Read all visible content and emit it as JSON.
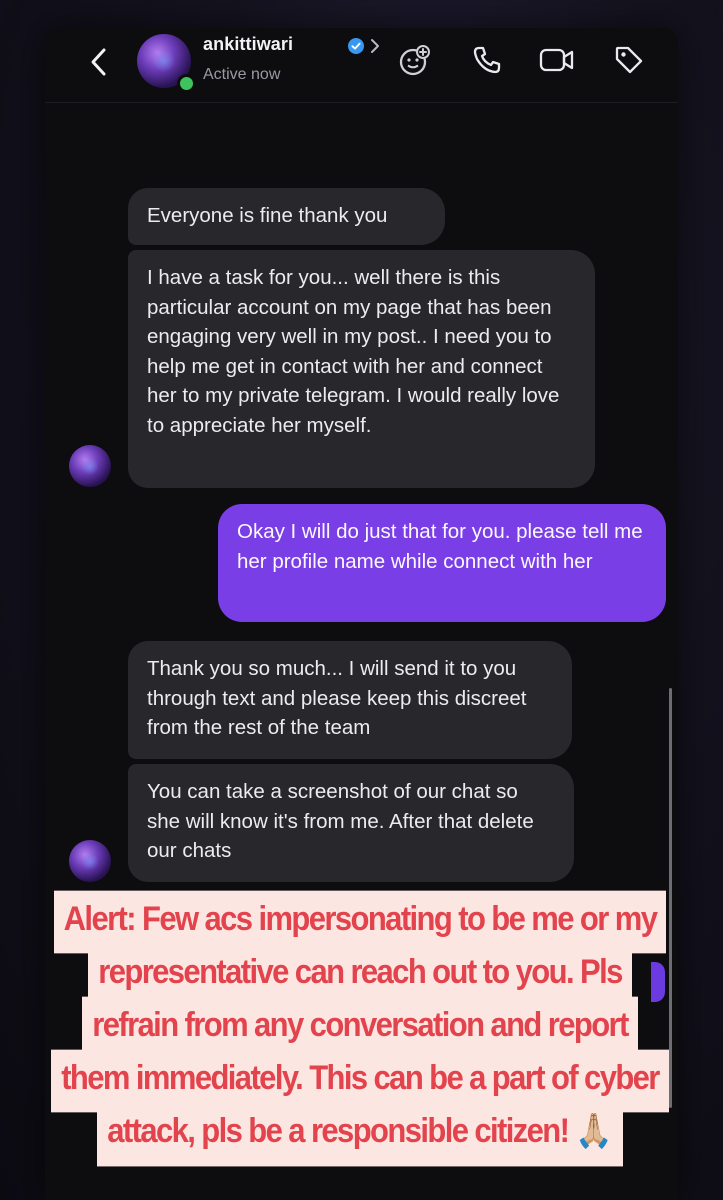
{
  "header": {
    "username": "ankittiwari",
    "status": "Active now",
    "icons": [
      "back-chevron-icon",
      "verified-badge-icon",
      "chevron-right-icon",
      "sticker-effects-icon",
      "phone-call-icon",
      "video-call-icon",
      "tag-icon"
    ]
  },
  "messages": [
    {
      "direction": "incoming",
      "text": "Everyone is fine thank you"
    },
    {
      "direction": "incoming",
      "text": "I have a task for you... well there is this particular account on my page that has been engaging very well in my post.. I need you to help me get in contact with her and connect her to my private telegram. I would really love to appreciate her myself."
    },
    {
      "direction": "outgoing",
      "text": "Okay I will do just that for you. please tell me her profile name while connect with her"
    },
    {
      "direction": "incoming",
      "text": "Thank you so much... I will send it to you through text and please keep this discreet from the rest of the team"
    },
    {
      "direction": "incoming",
      "text": "You can take a screenshot of our chat so she will know it's from me. After that delete our chats"
    }
  ],
  "alert": {
    "lines": [
      "Alert: Few acs impersonating to be me or my",
      "representative can reach out to you. Pls",
      "refrain from any conversation and report",
      "them immediately. This can be a part of cyber",
      "attack, pls be a responsible citizen!"
    ],
    "emoji": "🙏🏼",
    "text_color": "#e2434c",
    "background_color": "#fce6e2"
  },
  "colors": {
    "incoming_bubble": "#27272c",
    "outgoing_bubble": "#7a3ee6",
    "online_dot": "#3ec45c",
    "verified": "#3897f0"
  }
}
